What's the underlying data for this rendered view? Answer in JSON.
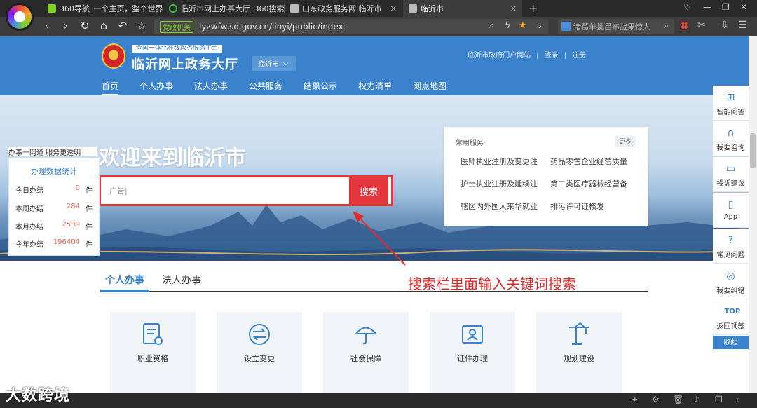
{
  "browser": {
    "tabs": [
      {
        "title": "360导航_一个主页，整个世界",
        "icon_color": "#7ed321"
      },
      {
        "title": "临沂市网上办事大厅_360搜索",
        "icon_color": "#3fbf4a"
      },
      {
        "title": "山东政务服务网 临沂市",
        "icon_color": "#bbbbbb"
      },
      {
        "title": "临沂市",
        "icon_color": "#bbbbbb"
      }
    ],
    "address": {
      "badge": "党政机关",
      "url": "lyzwfw.sd.gov.cn/linyi/public/index"
    },
    "search_placeholder": "诸葛单挑吕布战果惊人"
  },
  "header": {
    "platform_tag": "全国一体化在线政务服务平台",
    "site_title": "临沂网上政务大厅",
    "city_select": "临沂市",
    "top_links": {
      "portal": "临沂市政府门户网站",
      "login": "登录",
      "register": "注册",
      "sep": "|"
    },
    "nav": [
      "首页",
      "个人办事",
      "法人办事",
      "公共服务",
      "结果公示",
      "权力清单",
      "网点地图"
    ]
  },
  "banner": {
    "welcome": "欢迎来到临沂市",
    "search_value": "广告|",
    "search_button": "搜索"
  },
  "common_services": {
    "title": "常用服务",
    "more": "更多",
    "items": [
      "医师执业注册及变更注",
      "药品零售企业经营质量",
      "护士执业注册及延续注",
      "第二类医疗器械经营备",
      "辖区内外国人来华就业",
      "排污许可证核发"
    ]
  },
  "stats": {
    "header": "办事一网通  服务更透明",
    "title": "办理数据统计",
    "unit": "件",
    "rows": [
      {
        "label": "今日办结",
        "value": "0"
      },
      {
        "label": "本周办结",
        "value": "284"
      },
      {
        "label": "本月办结",
        "value": "2539"
      },
      {
        "label": "今年办结",
        "value": "196404"
      }
    ]
  },
  "tabs": [
    "个人办事",
    "法人办事"
  ],
  "annotation": "搜索栏里面输入关键词搜索",
  "cards": [
    {
      "label": "职业资格",
      "icon": "certificate-icon"
    },
    {
      "label": "设立变更",
      "icon": "exchange-icon"
    },
    {
      "label": "社会保障",
      "icon": "umbrella-icon"
    },
    {
      "label": "证件办理",
      "icon": "id-card-icon"
    },
    {
      "label": "规划建设",
      "icon": "crane-icon"
    }
  ],
  "sidebar": [
    {
      "label": "智能问答",
      "icon": "robot-icon"
    },
    {
      "label": "我要咨询",
      "icon": "headset-icon"
    },
    {
      "label": "投诉建议",
      "icon": "message-icon"
    },
    {
      "label": "App",
      "icon": "phone-icon"
    },
    {
      "label": "常见问题",
      "icon": "question-icon"
    },
    {
      "label": "我要纠错",
      "icon": "correct-icon"
    },
    {
      "label": "返回顶部",
      "icon": "top-icon"
    }
  ],
  "sidebar_top_label": "TOP",
  "sidebar_collapse": "收起",
  "watermark": "大数跨境"
}
